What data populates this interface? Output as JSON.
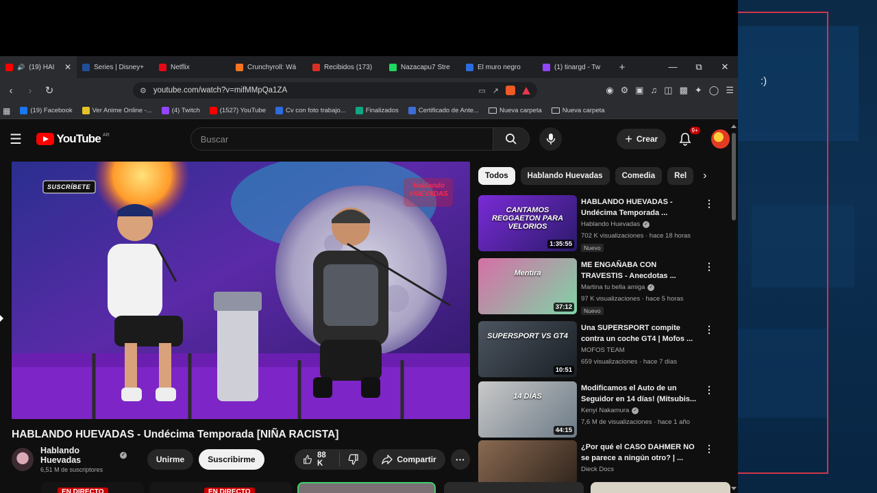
{
  "browser": {
    "tabs": [
      {
        "title": "(19) HAÍ",
        "favicon_color": "#ff0000",
        "active": true,
        "audio_icon": "🔊"
      },
      {
        "title": "Series | Disney+",
        "favicon_color": "#1f4e9a"
      },
      {
        "title": "Netflix",
        "favicon_color": "#e50914"
      },
      {
        "title": "Crunchyroll: Wá",
        "favicon_color": "#f47521"
      },
      {
        "title": "Recibidos (173)",
        "favicon_color": "#d93025"
      },
      {
        "title": "Nazacapu7 Stre",
        "favicon_color": "#1ed760"
      },
      {
        "title": "El muro negro",
        "favicon_color": "#2d6cdf"
      },
      {
        "title": "(1) tinargd - Tw",
        "favicon_color": "#9146ff"
      }
    ],
    "new_tab": "+",
    "window_controls": {
      "minimize": "—",
      "maximize": "⧉",
      "close": "✕"
    },
    "url": "youtube.com/watch?v=mifMMpQa1ZA",
    "bookmarks": [
      {
        "label": "(19) Facebook",
        "favicon_color": "#1877f2"
      },
      {
        "label": "Ver Anime Online -...",
        "favicon_color": "#e6c229"
      },
      {
        "label": "(4) Twitch",
        "favicon_color": "#9146ff"
      },
      {
        "label": "(1527) YouTube",
        "favicon_color": "#ff0000"
      },
      {
        "label": "Cv con foto trabajo...",
        "favicon_color": "#2d6cdf"
      },
      {
        "label": "Finalizados",
        "favicon_color": "#11a683"
      },
      {
        "label": "Certificado de Ante...",
        "favicon_color": "#3c6ed6"
      },
      {
        "label": "Nueva carpeta",
        "folder": true
      },
      {
        "label": "Nueva carpeta",
        "folder": true
      }
    ]
  },
  "youtube": {
    "logo_text": "YouTube",
    "logo_country": "AR",
    "search_placeholder": "Buscar",
    "create_label": "Crear",
    "notifications_badge": "9+",
    "video": {
      "title": "HABLANDO HUEVADAS - Undécima Temporada [NIÑA RACISTA]",
      "overlay_subscribe": "SUSCRÍBETE",
      "overlay_logo": "Hablando HUEVADAS"
    },
    "channel": {
      "name": "Hablando Huevadas",
      "subscribers": "6,51 M de suscriptores",
      "join_label": "Unirme",
      "subscribe_label": "Suscribirme"
    },
    "actions": {
      "likes": "88 K",
      "share_label": "Compartir"
    },
    "chips": [
      "Todos",
      "Hablando Huevadas",
      "Comedia",
      "Rel"
    ],
    "recommendations": [
      {
        "title": "HABLANDO HUEVADAS - Undécima Temporada ...",
        "channel": "Hablando Huevadas",
        "verified": true,
        "meta": "702 K visualizaciones · hace 18 horas",
        "badge": "Nuevo",
        "duration": "1:35:55",
        "thumb_text": "CANTAMOS REGGAETON PARA VELORIOS",
        "thumb_colors": [
          "#7a2bd6",
          "#2b1a6b"
        ]
      },
      {
        "title": "ME ENGAÑABA CON TRAVESTIS - Anecdotas ...",
        "channel": "Martina tu bella amiga",
        "verified": true,
        "meta": "97 K visualizaciones · hace 5 horas",
        "badge": "Nuevo",
        "duration": "37:12",
        "thumb_text": "Mentira",
        "thumb_colors": [
          "#d66fa6",
          "#7fd3a6"
        ]
      },
      {
        "title": "Una SUPERSPORT compite contra un coche GT4 | Mofos ...",
        "channel": "MOFOS TEAM",
        "verified": false,
        "meta": "659 visualizaciones · hace 7 días",
        "badge": "",
        "duration": "10:51",
        "thumb_text": "SUPERSPORT VS GT4",
        "thumb_colors": [
          "#4c5560",
          "#1a1f25"
        ]
      },
      {
        "title": "Modificamos el Auto de un Seguidor en 14 días! (Mitsubis...",
        "channel": "Kenyi Nakamura",
        "verified": true,
        "meta": "7,6 M de visualizaciones · hace 1 año",
        "badge": "",
        "duration": "44:15",
        "thumb_text": "14 DÍAS",
        "thumb_colors": [
          "#c9c9c9",
          "#6c7a86"
        ]
      },
      {
        "title": "¿Por qué el CASO DAHMER NO se parece a ningún otro? | ...",
        "channel": "Dieck Docs",
        "verified": false,
        "meta": "",
        "badge": "",
        "duration": "",
        "thumb_text": "",
        "thumb_colors": [
          "#8a6a52",
          "#2a1f18"
        ]
      }
    ],
    "bottom_live_labels": [
      "EN DIRECTO",
      "EN DIRECTO"
    ]
  },
  "desktop": {
    "side_text": ":)"
  }
}
